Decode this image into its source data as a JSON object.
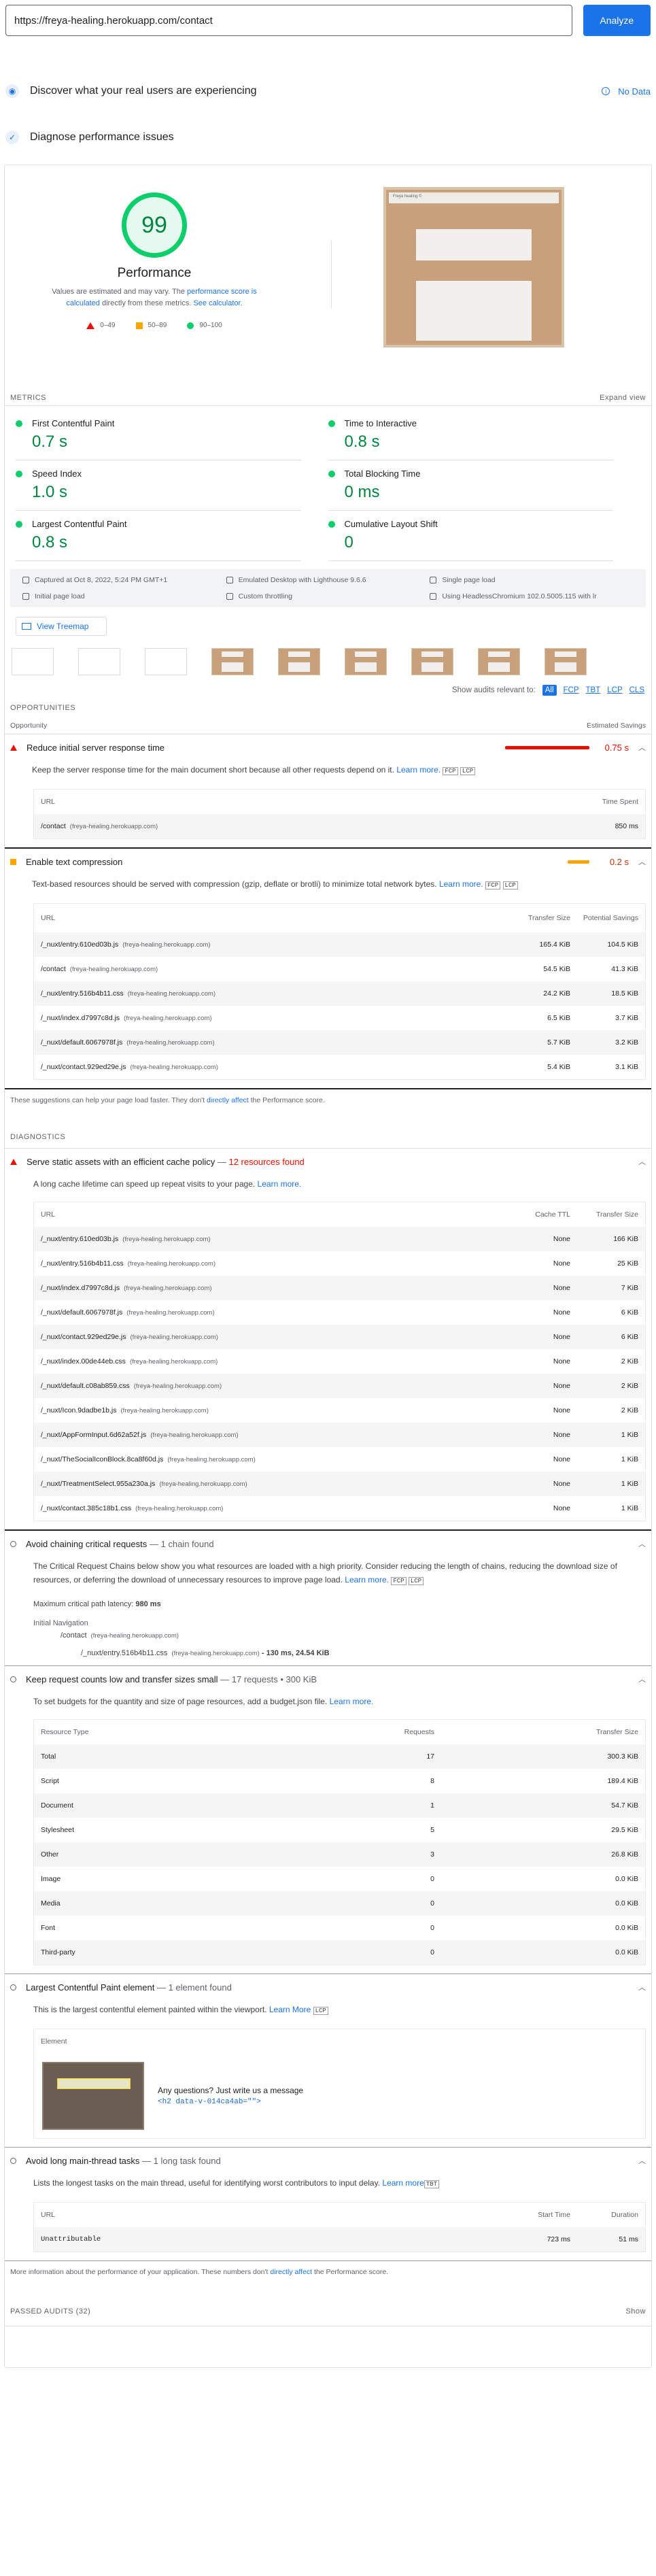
{
  "url_input": {
    "value": "https://freya-healing.herokuapp.com/contact"
  },
  "analyze_label": "Analyze",
  "field_data": {
    "title": "Discover what your real users are experiencing",
    "status": "No Data"
  },
  "diagnose": {
    "title": "Diagnose performance issues"
  },
  "score": {
    "value": "99",
    "label": "Performance",
    "desc_pre": "Values are estimated and may vary. The ",
    "desc_link1": "performance score is calculated",
    "desc_mid": " directly from these metrics. ",
    "desc_link2": "See calculator.",
    "legend": [
      "0–49",
      "50–89",
      "90–100"
    ]
  },
  "screenshot": {
    "title": "Freya healing ©"
  },
  "metrics": {
    "header": "METRICS",
    "expand": "Expand view",
    "items": [
      {
        "label": "First Contentful Paint",
        "value": "0.7 s"
      },
      {
        "label": "Time to Interactive",
        "value": "0.8 s"
      },
      {
        "label": "Speed Index",
        "value": "1.0 s"
      },
      {
        "label": "Total Blocking Time",
        "value": "0 ms"
      },
      {
        "label": "Largest Contentful Paint",
        "value": "0.8 s"
      },
      {
        "label": "Cumulative Layout Shift",
        "value": "0"
      }
    ]
  },
  "runtime": [
    "Captured at Oct 8, 2022, 5:24 PM GMT+1",
    "Emulated Desktop with Lighthouse 9.6.6",
    "Single page load",
    "Initial page load",
    "Custom throttling",
    "Using HeadlessChromium 102.0.5005.115 with lr"
  ],
  "treemap_label": "View Treemap",
  "filter": {
    "label": "Show audits relevant to:",
    "chips": [
      "All",
      "FCP",
      "TBT",
      "LCP",
      "CLS"
    ]
  },
  "opportunities": {
    "header": "OPPORTUNITIES",
    "col1": "Opportunity",
    "col2": "Estimated Savings",
    "server": {
      "title": "Reduce initial server response time",
      "savings": "0.75 s",
      "desc": "Keep the server response time for the main document short because all other requests depend on it.",
      "learn": "Learn more.",
      "tags": [
        "FCP",
        "LCP"
      ],
      "headers": [
        "URL",
        "Time Spent"
      ],
      "rows": [
        {
          "url": "/contact",
          "host": "(freya-healing.herokuapp.com)",
          "value": "850 ms"
        }
      ]
    },
    "compression": {
      "title": "Enable text compression",
      "savings": "0.2 s",
      "desc": "Text-based resources should be served with compression (gzip, deflate or brotli) to minimize total network bytes.",
      "learn": "Learn more.",
      "tags": [
        "FCP",
        "LCP"
      ],
      "headers": [
        "URL",
        "Transfer Size",
        "Potential Savings"
      ],
      "rows": [
        {
          "url": "/_nuxt/entry.610ed03b.js",
          "host": "(freya-healing.herokuapp.com)",
          "size": "165.4 KiB",
          "save": "104.5 KiB"
        },
        {
          "url": "/contact",
          "host": "(freya-healing.herokuapp.com)",
          "size": "54.5 KiB",
          "save": "41.3 KiB"
        },
        {
          "url": "/_nuxt/entry.516b4b11.css",
          "host": "(freya-healing.herokuapp.com)",
          "size": "24.2 KiB",
          "save": "18.5 KiB"
        },
        {
          "url": "/_nuxt/index.d7997c8d.js",
          "host": "(freya-healing.herokuapp.com)",
          "size": "6.5 KiB",
          "save": "3.7 KiB"
        },
        {
          "url": "/_nuxt/default.6067978f.js",
          "host": "(freya-healing.herokuapp.com)",
          "size": "5.7 KiB",
          "save": "3.2 KiB"
        },
        {
          "url": "/_nuxt/contact.929ed29e.js",
          "host": "(freya-healing.herokuapp.com)",
          "size": "5.4 KiB",
          "save": "3.1 KiB"
        }
      ]
    },
    "footnote_pre": "These suggestions can help your page load faster. They don't ",
    "footnote_link": "directly affect",
    "footnote_post": " the Performance score."
  },
  "diagnostics": {
    "header": "DIAGNOSTICS",
    "cache": {
      "title": "Serve static assets with an efficient cache policy",
      "count": "12 resources found",
      "desc": "A long cache lifetime can speed up repeat visits to your page.",
      "learn": "Learn more.",
      "headers": [
        "URL",
        "Cache TTL",
        "Transfer Size"
      ],
      "rows": [
        {
          "url": "/_nuxt/entry.610ed03b.js",
          "ttl": "None",
          "size": "166 KiB"
        },
        {
          "url": "/_nuxt/entry.516b4b11.css",
          "ttl": "None",
          "size": "25 KiB"
        },
        {
          "url": "/_nuxt/index.d7997c8d.js",
          "ttl": "None",
          "size": "7 KiB"
        },
        {
          "url": "/_nuxt/default.6067978f.js",
          "ttl": "None",
          "size": "6 KiB"
        },
        {
          "url": "/_nuxt/contact.929ed29e.js",
          "ttl": "None",
          "size": "6 KiB"
        },
        {
          "url": "/_nuxt/index.00de44eb.css",
          "ttl": "None",
          "size": "2 KiB"
        },
        {
          "url": "/_nuxt/default.c08ab859.css",
          "ttl": "None",
          "size": "2 KiB"
        },
        {
          "url": "/_nuxt/Icon.9dadbe1b.js",
          "ttl": "None",
          "size": "2 KiB"
        },
        {
          "url": "/_nuxt/AppFormInput.6d62a52f.js",
          "ttl": "None",
          "size": "1 KiB"
        },
        {
          "url": "/_nuxt/TheSocialIconBlock.8ca8f60d.js",
          "ttl": "None",
          "size": "1 KiB"
        },
        {
          "url": "/_nuxt/TreatmentSelect.955a230a.js",
          "ttl": "None",
          "size": "1 KiB"
        },
        {
          "url": "/_nuxt/contact.385c18b1.css",
          "ttl": "None",
          "size": "1 KiB"
        }
      ],
      "host": "(freya-healing.herokuapp.com)"
    },
    "chains": {
      "title": "Avoid chaining critical requests",
      "count": "1 chain found",
      "desc": "The Critical Request Chains below show you what resources are loaded with a high priority. Consider reducing the length of chains, reducing the download size of resources, or deferring the download of unnecessary resources to improve page load.",
      "learn": "Learn more.",
      "tags": [
        "FCP",
        "LCP"
      ],
      "latency_label": "Maximum critical path latency:",
      "latency": "980 ms",
      "nav": "Initial Navigation",
      "node1": "/contact",
      "node1_host": "(freya-healing.herokuapp.com)",
      "node2": "/_nuxt/entry.516b4b11.css",
      "node2_host": "(freya-healing.herokuapp.com)",
      "node2_stats": "- 130 ms, 24.54 KiB"
    },
    "budget": {
      "title": "Keep request counts low and transfer sizes small",
      "count": "17 requests • 300 KiB",
      "desc": "To set budgets for the quantity and size of page resources, add a budget.json file.",
      "learn": "Learn more.",
      "headers": [
        "Resource Type",
        "Requests",
        "Transfer Size"
      ],
      "rows": [
        {
          "type": "Total",
          "req": "17",
          "size": "300.3 KiB"
        },
        {
          "type": "Script",
          "req": "8",
          "size": "189.4 KiB"
        },
        {
          "type": "Document",
          "req": "1",
          "size": "54.7 KiB"
        },
        {
          "type": "Stylesheet",
          "req": "5",
          "size": "29.5 KiB"
        },
        {
          "type": "Other",
          "req": "3",
          "size": "26.8 KiB"
        },
        {
          "type": "Image",
          "req": "0",
          "size": "0.0 KiB"
        },
        {
          "type": "Media",
          "req": "0",
          "size": "0.0 KiB"
        },
        {
          "type": "Font",
          "req": "0",
          "size": "0.0 KiB"
        },
        {
          "type": "Third-party",
          "req": "0",
          "size": "0.0 KiB"
        }
      ]
    },
    "lcp": {
      "title": "Largest Contentful Paint element",
      "count": "1 element found",
      "desc": "This is the largest contentful element painted within the viewport.",
      "learn": "Learn More",
      "tags": [
        "LCP"
      ],
      "header": "Element",
      "text": "Any questions? Just write us a message",
      "code": "<h2 data-v-014ca4ab=\"\">"
    },
    "longtasks": {
      "title": "Avoid long main-thread tasks",
      "count": "1 long task found",
      "desc": "Lists the longest tasks on the main thread, useful for identifying worst contributors to input delay.",
      "learn": "Learn more",
      "tags": [
        "TBT"
      ],
      "headers": [
        "URL",
        "Start Time",
        "Duration"
      ],
      "rows": [
        {
          "url": "Unattributable",
          "start": "723 ms",
          "dur": "51 ms"
        }
      ]
    },
    "footnote_pre": "More information about the performance of your application. These numbers don't ",
    "footnote_link": "directly affect",
    "footnote_post": " the Performance score."
  },
  "passed": {
    "label": "PASSED AUDITS",
    "count": "(32)",
    "show": "Show"
  }
}
